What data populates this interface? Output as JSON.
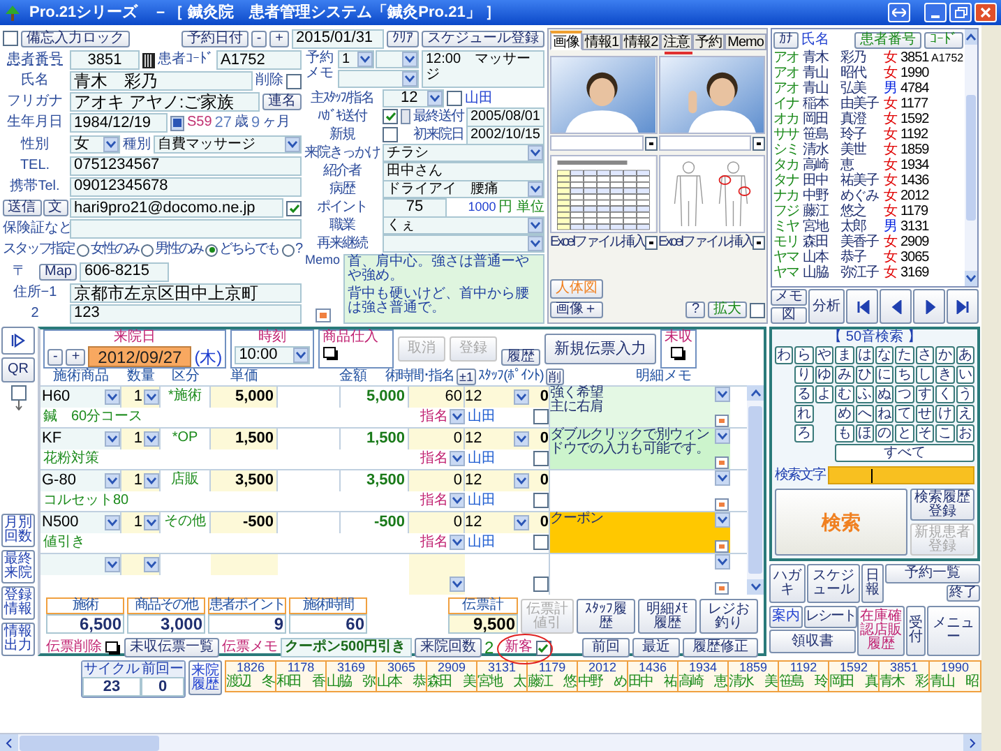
{
  "window": {
    "title": "Pro.21シリーズ　－［ 鍼灸院　患者管理システム「鍼灸Pro.21」 ］"
  },
  "patient": {
    "memo_lock": {
      "label": "備忘入力ロック",
      "checked": false
    },
    "number": {
      "label": "患者番号",
      "value": "3851"
    },
    "code": {
      "label": "患者ｺｰﾄﾞ",
      "value": "A1752"
    },
    "name": {
      "label": "氏名",
      "value": "青木　彩乃"
    },
    "delete": {
      "label": "削除",
      "checked": false
    },
    "kana": {
      "label": "フリガナ",
      "value": "アオキ アヤノ:ご家族",
      "button": "連名"
    },
    "birth": {
      "label": "生年月日",
      "value": "1984/12/19",
      "era": "S59",
      "years": "27",
      "years_unit": "歳",
      "months": "9",
      "months_unit": "ヶ月"
    },
    "sex": {
      "label": "性別",
      "value": "女"
    },
    "type": {
      "label": "種別",
      "value": "自費マッサージ"
    },
    "tel": {
      "label": "TEL.",
      "value": "0751234567"
    },
    "mobile": {
      "label": "携帯Tel.",
      "value": "09012345678"
    },
    "email": {
      "send_button": "送信",
      "text_button": "文",
      "value": "hari9pro21@docomo.ne.jp",
      "checked": true
    },
    "insurance": {
      "label": "保険証など"
    },
    "staff_pref": {
      "label": "スタッフ指定",
      "options": [
        {
          "label": "女性のみ",
          "selected": false
        },
        {
          "label": "男性のみ",
          "selected": false
        },
        {
          "label": "どちらでも",
          "selected": true
        },
        {
          "label": "?",
          "selected": false
        }
      ]
    },
    "postal": {
      "label": "〒",
      "map_button": "Map",
      "value": "606-8215"
    },
    "address1": {
      "label": "住所−1",
      "value": "京都市左京区田中上京町"
    },
    "address2": {
      "label": "2",
      "value": "123"
    }
  },
  "reservation": {
    "date_button": "予約日付",
    "minus": "-",
    "plus": "+",
    "date": "2015/01/31",
    "clear_button": "ｸﾘｱ",
    "schedule_button": "スケジュール登録",
    "memo_label": "予約メモ",
    "slot": "1",
    "memo": "12:00　マッサージ"
  },
  "details": {
    "staff": {
      "label": "主ｽﾀｯﾌ/指名",
      "value": "12",
      "nominated": false,
      "name": "山田"
    },
    "postcard": {
      "label": "ﾊｶﾞｷ送付",
      "checked": true,
      "last_label": "最終送付",
      "last": "2005/08/01"
    },
    "new": {
      "label": "新規",
      "checked": false,
      "first_label": "初来院日",
      "first": "2002/10/15"
    },
    "trigger": {
      "label": "来院きっかけ",
      "value": "チラシ"
    },
    "referrer": {
      "label": "紹介者",
      "value": "田中さん"
    },
    "history": {
      "label": "病歴",
      "value": "ドライアイ　腰痛"
    },
    "points": {
      "label": "ポイント",
      "value": "75",
      "unit": "1000",
      "unit_text": "円 単位"
    },
    "job": {
      "label": "職業",
      "value": "くぇ"
    },
    "revisit": {
      "label": "再来継続"
    },
    "memo": {
      "label": "Memo",
      "lines": [
        "首、肩中心。強さは普通ーやや強め。",
        "背中も硬いけど、首中から腰は強さ普通で。"
      ]
    }
  },
  "tabs": [
    {
      "label": "画像",
      "selected": true
    },
    {
      "label": "情報1",
      "selected": false
    },
    {
      "label": "情報2",
      "selected": false
    },
    {
      "label": "注意",
      "selected": false
    },
    {
      "label": "予約",
      "selected": false
    },
    {
      "label": "Memo",
      "selected": false
    }
  ],
  "images": [
    {
      "kind": "picture"
    },
    {
      "kind": "picture"
    },
    {
      "kind": "sheet",
      "caption": "Excelファイル挿入"
    },
    {
      "kind": "body",
      "caption": "Excelファイル挿入"
    }
  ],
  "image_buttons": {
    "body_chart": "人体図",
    "add_image": "画像＋",
    "help": "?",
    "zoom": "拡大",
    "checked": false
  },
  "patient_list": {
    "kana_button": "ｶﾅ",
    "name_header": "氏名",
    "number_button": "患者番号",
    "code_button": "ｺｰﾄﾞ",
    "rows": [
      {
        "kana": "アオ",
        "name": "青木　彩乃",
        "gender": "女",
        "color": "#e00000",
        "number": "3851",
        "code": "A1752"
      },
      {
        "kana": "アオ",
        "name": "青山　昭代",
        "gender": "女",
        "color": "#e00000",
        "number": "1990"
      },
      {
        "kana": "アオ",
        "name": "青山　弘美",
        "gender": "男",
        "color": "#0020e0",
        "number": "4784"
      },
      {
        "kana": "イナ",
        "name": "稲本　由美子",
        "gender": "女",
        "color": "#e00000",
        "number": "1177"
      },
      {
        "kana": "オカ",
        "name": "岡田　真澄",
        "gender": "女",
        "color": "#e00000",
        "number": "1592"
      },
      {
        "kana": "ササ",
        "name": "笹島　玲子",
        "gender": "女",
        "color": "#e00000",
        "number": "1192"
      },
      {
        "kana": "シミ",
        "name": "清水　美世",
        "gender": "女",
        "color": "#e00000",
        "number": "1859"
      },
      {
        "kana": "タカ",
        "name": "高崎　恵",
        "gender": "女",
        "color": "#e00000",
        "number": "1934"
      },
      {
        "kana": "タナ",
        "name": "田中　祐美子",
        "gender": "女",
        "color": "#e00000",
        "number": "1436"
      },
      {
        "kana": "ナカ",
        "name": "中野　めぐみ",
        "gender": "女",
        "color": "#e00000",
        "number": "2012"
      },
      {
        "kana": "フジ",
        "name": "藤江　悠之",
        "gender": "女",
        "color": "#e00000",
        "number": "1179"
      },
      {
        "kana": "ミヤ",
        "name": "宮地　太郎",
        "gender": "男",
        "color": "#0020e0",
        "number": "3131"
      },
      {
        "kana": "モリ",
        "name": "森田　美香子",
        "gender": "女",
        "color": "#e00000",
        "number": "2909"
      },
      {
        "kana": "ヤマ",
        "name": "山本　恭子",
        "gender": "女",
        "color": "#e00000",
        "number": "3065"
      },
      {
        "kana": "ヤマ",
        "name": "山脇　弥江子",
        "gender": "女",
        "color": "#e00000",
        "number": "3169"
      }
    ],
    "memo_button": "メモ",
    "figure_button": "図",
    "analysis_button": "分析"
  },
  "side_buttons": {
    "qr": "QR",
    "checked": false,
    "lower": [
      "月別回数",
      "最終来院",
      "登録情報",
      "情報出力"
    ]
  },
  "slip": {
    "date_label": "来院日",
    "minus": "-",
    "plus": "+",
    "date": "2012/09/27",
    "weekday": "(木)",
    "time_label": "時刻",
    "time": "10:00",
    "purchase_label": "商品仕入",
    "cancel": {
      "label": "取消",
      "disabled": true
    },
    "register": {
      "label": "登録",
      "disabled": true
    },
    "history_button": "履歴",
    "new_button": "新規伝票入力",
    "unpaid_label": "未収",
    "columns": [
      "施術商品",
      "数量",
      "区分",
      "単価",
      "金額",
      "術時間･指名",
      "±1",
      "ｽﾀｯﾌ(ﾎﾟｲﾝﾄ)",
      "削",
      "明細メモ"
    ],
    "items": [
      {
        "kind": "item",
        "code": "H60",
        "qty": "1",
        "category": "*施術",
        "unit_price": "5,000",
        "amount": "5,000",
        "time": "60",
        "staff": "12",
        "points": "0",
        "name": "鍼　60分コース",
        "nomination": "指名",
        "staff_name": "山田",
        "checked": false,
        "memo": [
          "強く希望",
          "主に右肩"
        ],
        "color": "#e4f8e4"
      },
      {
        "kind": "item",
        "code": "KF",
        "qty": "1",
        "category": "*OP",
        "unit_price": "1,500",
        "amount": "1,500",
        "time": "0",
        "staff": "12",
        "points": "0",
        "name": "花粉対策",
        "nomination": "指名",
        "staff_name": "山田",
        "checked": false,
        "memo": [
          "ダブルクリックで別ウィンドウでの入力も可能です。"
        ],
        "color": "#ccf4cc"
      },
      {
        "kind": "item",
        "code": "G-80",
        "qty": "1",
        "category": "店販",
        "unit_price": "3,500",
        "amount": "3,500",
        "time": "0",
        "staff": "12",
        "points": "0",
        "name": "コルセット80",
        "nomination": "指名",
        "staff_name": "山田",
        "checked": false,
        "color": "#ffffff"
      },
      {
        "kind": "item",
        "code": "N500",
        "qty": "1",
        "category": "その他",
        "unit_price": "-500",
        "amount": "-500",
        "time": "0",
        "staff": "12",
        "points": "0",
        "name": "値引き",
        "nomination": "指名",
        "staff_name": "山田",
        "checked": false,
        "memo": [
          "クーポン"
        ],
        "color": "#ffc800"
      },
      {
        "kind": "empty",
        "checked": false
      }
    ],
    "totals": [
      {
        "label": "施術",
        "value": "6,500"
      },
      {
        "label": "商品その他",
        "value": "3,000"
      },
      {
        "label": "患者ポイント",
        "value": "9"
      },
      {
        "label": "施術時間",
        "value": "60"
      }
    ],
    "slip_total": {
      "label": "伝票計",
      "value": "9,500"
    },
    "discount": {
      "label": "伝票計値引",
      "disabled": true
    },
    "history_buttons": [
      "ｽﾀｯﾌ履歴",
      "明細ﾒﾓ履歴",
      "レジお釣り"
    ],
    "delete_label": "伝票削除",
    "unpaid_list_button": "未収伝票一覧",
    "memo_label": "伝票メモ",
    "memo": "クーポン500円引き",
    "visits_button": "来院回数",
    "visits": "2",
    "new_customer": {
      "label": "新客",
      "checked": true
    },
    "nav_buttons": [
      "前回",
      "最近",
      "履歴修正"
    ]
  },
  "kana_search": {
    "title": "【 50音検索 】",
    "rows": [
      [
        "わ",
        "ら",
        "や",
        "ま",
        "は",
        "な",
        "た",
        "さ",
        "か",
        "あ"
      ],
      [
        null,
        "り",
        "ゆ",
        "み",
        "ひ",
        "に",
        "ち",
        "し",
        "き",
        "い"
      ],
      [
        null,
        "る",
        "よ",
        "む",
        "ふ",
        "ぬ",
        "つ",
        "す",
        "く",
        "う"
      ],
      [
        null,
        "れ",
        null,
        "め",
        "へ",
        "ね",
        "て",
        "せ",
        "け",
        "え"
      ],
      [
        null,
        "ろ",
        null,
        "も",
        "ほ",
        "の",
        "と",
        "そ",
        "こ",
        "お"
      ]
    ],
    "all_button": "すべて",
    "search_label": "検索文字",
    "search_button": "検索",
    "save_history_button": "検索履歴登録",
    "new_patient": {
      "label": "新規患者登録",
      "disabled": true
    }
  },
  "function_buttons": {
    "postcard": "ハガキ",
    "schedule": "スケジュール",
    "daily": "日報",
    "reservations": "予約一覧",
    "end": "終了",
    "guide": "案内",
    "receipt": "レシート",
    "invoice": "領収書",
    "stock": "在庫確認店販履歴",
    "reception": "受付",
    "menu": "メニュー"
  },
  "recent": {
    "cycle_label": "サイクル",
    "cycle": "23",
    "previous_label": "前回ー",
    "previous": "0",
    "history_button": "来院履歴",
    "patients": [
      {
        "number": "1826",
        "name": "渡辺　冬"
      },
      {
        "number": "1178",
        "name": "和田　香"
      },
      {
        "number": "3169",
        "name": "山脇　弥"
      },
      {
        "number": "3065",
        "name": "山本　恭"
      },
      {
        "number": "2909",
        "name": "森田　美"
      },
      {
        "number": "3131",
        "name": "宮地　太"
      },
      {
        "number": "1179",
        "name": "藤江　悠"
      },
      {
        "number": "2012",
        "name": "中野　め"
      },
      {
        "number": "1436",
        "name": "田中　祐"
      },
      {
        "number": "1934",
        "name": "高崎　恵"
      },
      {
        "number": "1859",
        "name": "清水　美"
      },
      {
        "number": "1192",
        "name": "笹島　玲"
      },
      {
        "number": "1592",
        "name": "岡田　真"
      },
      {
        "number": "3851",
        "name": "青木　彩"
      },
      {
        "number": "1990",
        "name": "青山　昭"
      }
    ]
  }
}
